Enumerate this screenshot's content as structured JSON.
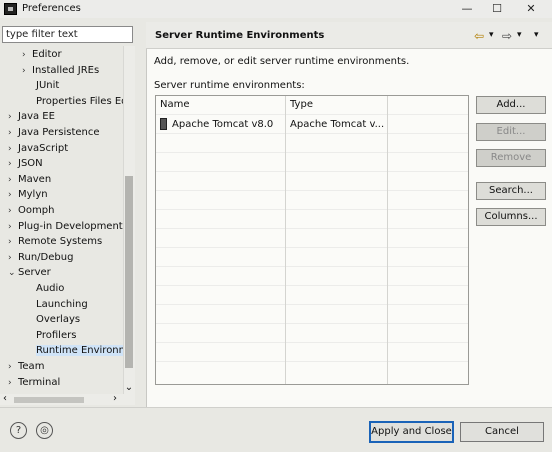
{
  "window": {
    "title": "Preferences",
    "minimize_glyph": "—",
    "maximize_glyph": "☐",
    "close_glyph": "✕"
  },
  "filter": {
    "placeholder": "type filter text"
  },
  "tree": [
    {
      "label": "Editor",
      "chevron": "›"
    },
    {
      "label": "Installed JREs",
      "chevron": "›"
    },
    {
      "label": "JUnit",
      "chevron": ""
    },
    {
      "label": "Properties Files Ed",
      "chevron": ""
    },
    {
      "label": "Java EE",
      "chevron": "›"
    },
    {
      "label": "Java Persistence",
      "chevron": "›"
    },
    {
      "label": "JavaScript",
      "chevron": "›"
    },
    {
      "label": "JSON",
      "chevron": "›"
    },
    {
      "label": "Maven",
      "chevron": "›"
    },
    {
      "label": "Mylyn",
      "chevron": "›"
    },
    {
      "label": "Oomph",
      "chevron": "›"
    },
    {
      "label": "Plug-in Development",
      "chevron": "›"
    },
    {
      "label": "Remote Systems",
      "chevron": "›"
    },
    {
      "label": "Run/Debug",
      "chevron": "›"
    },
    {
      "label": "Server",
      "chevron": "⌄"
    },
    {
      "label": "Audio",
      "chevron": ""
    },
    {
      "label": "Launching",
      "chevron": ""
    },
    {
      "label": "Overlays",
      "chevron": ""
    },
    {
      "label": "Profilers",
      "chevron": ""
    },
    {
      "label": "Runtime Environm",
      "chevron": ""
    },
    {
      "label": "Team",
      "chevron": "›"
    },
    {
      "label": "Terminal",
      "chevron": "›"
    }
  ],
  "page": {
    "title": "Server Runtime Environments",
    "description": "Add, remove, or edit server runtime environments.",
    "list_label": "Server runtime environments:",
    "nav_back": "⇦",
    "nav_forward": "⇨",
    "dropdown_glyph": "▾"
  },
  "table": {
    "columns": [
      "Name",
      "Type"
    ],
    "rows": [
      {
        "name": "Apache Tomcat v8.0",
        "type": "Apache Tomcat v..."
      }
    ]
  },
  "buttons": {
    "add": "Add...",
    "edit": "Edit...",
    "remove": "Remove",
    "search": "Search...",
    "columns": "Columns...",
    "apply_close": "Apply and Close",
    "cancel": "Cancel",
    "help_glyph": "?",
    "import_glyph": "◎"
  },
  "scroll": {
    "left_glyph": "‹",
    "right_glyph": "›",
    "down_glyph": "⌄"
  },
  "colors": {
    "selection": "#cfe3f7",
    "focus": "#1a63b8"
  }
}
